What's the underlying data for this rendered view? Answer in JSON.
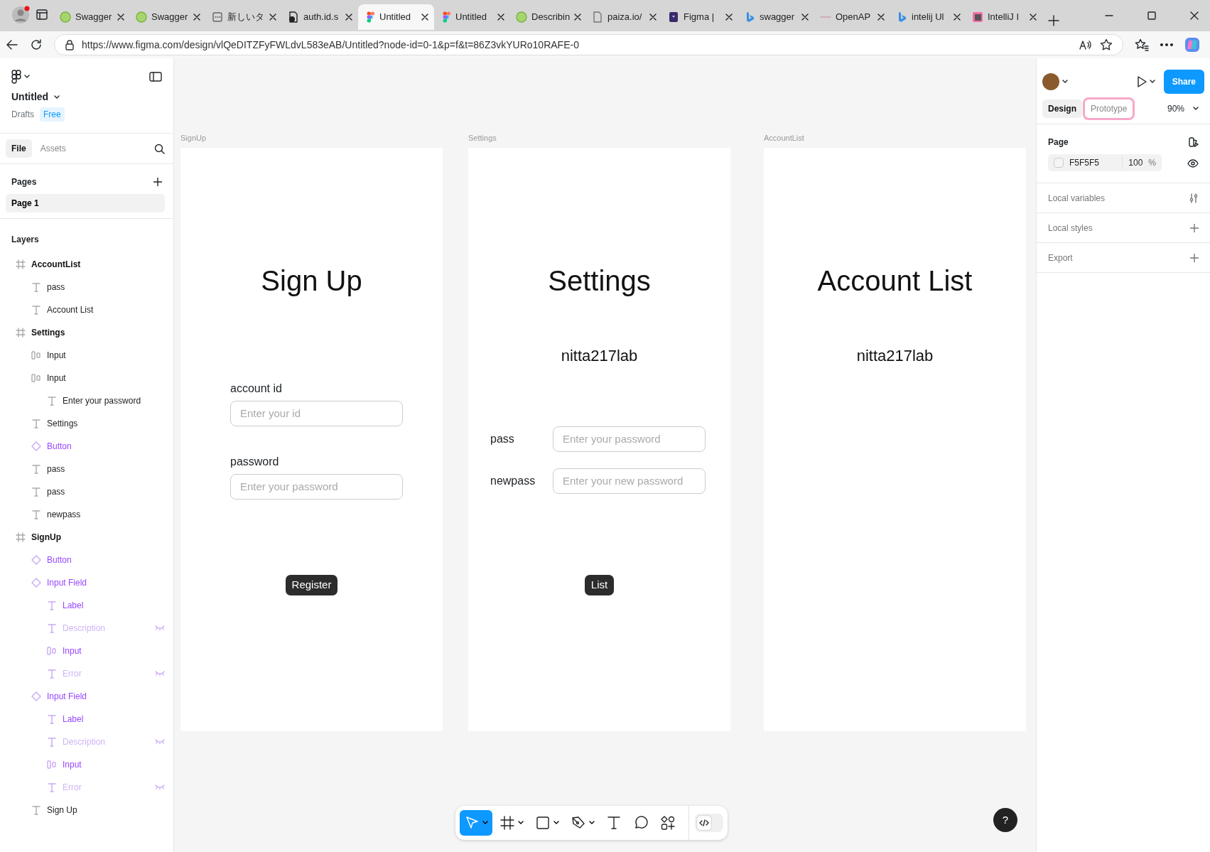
{
  "browser": {
    "tabs": [
      {
        "title": "Swagger",
        "kind": "swagger",
        "selected": false
      },
      {
        "title": "Swagger",
        "kind": "swagger",
        "selected": false
      },
      {
        "title": "新しいタ",
        "kind": "newtab",
        "selected": false
      },
      {
        "title": "auth.id.s",
        "kind": "doc",
        "selected": false
      },
      {
        "title": "Untitled",
        "kind": "figma",
        "selected": true
      },
      {
        "title": "Untitled",
        "kind": "figma",
        "selected": false
      },
      {
        "title": "Describin",
        "kind": "swagger",
        "selected": false
      },
      {
        "title": "paiza.io/",
        "kind": "page",
        "selected": false
      },
      {
        "title": "Figma |",
        "kind": "purple",
        "selected": false
      },
      {
        "title": "swagger",
        "kind": "bing",
        "selected": false
      },
      {
        "title": "OpenAP",
        "kind": "line",
        "selected": false
      },
      {
        "title": "intelij Ul",
        "kind": "bing",
        "selected": false
      },
      {
        "title": "IntelliJ I",
        "kind": "intellij",
        "selected": false
      }
    ],
    "url": "https://www.figma.com/design/vlQeDITZFyFWLdvL583eAB/Untitled?node-id=0-1&p=f&t=86Z3vkYURo10RAFE-0"
  },
  "left_panel": {
    "file_name": "Untitled",
    "location": "Drafts",
    "plan_badge": "Free",
    "tabs": [
      {
        "label": "File",
        "selected": true
      },
      {
        "label": "Assets",
        "selected": false
      }
    ],
    "pages_title": "Pages",
    "pages": [
      {
        "label": "Page 1",
        "selected": true
      }
    ],
    "layers_title": "Layers",
    "layers": [
      {
        "name": "AccountList",
        "kind": "frame",
        "children": [
          {
            "name": "pass",
            "kind": "text"
          },
          {
            "name": "Account List",
            "kind": "text"
          }
        ]
      },
      {
        "name": "Settings",
        "kind": "frame",
        "children": [
          {
            "name": "Input",
            "kind": "autolayout"
          },
          {
            "name": "Input",
            "kind": "autolayout",
            "children": [
              {
                "name": "Enter your password",
                "kind": "text"
              }
            ]
          },
          {
            "name": "Settings",
            "kind": "text"
          },
          {
            "name": "Button",
            "kind": "component"
          },
          {
            "name": "pass",
            "kind": "text"
          },
          {
            "name": "pass",
            "kind": "text"
          },
          {
            "name": "newpass",
            "kind": "text"
          }
        ]
      },
      {
        "name": "SignUp",
        "kind": "frame",
        "children": [
          {
            "name": "Button",
            "kind": "component"
          },
          {
            "name": "Input Field",
            "kind": "component",
            "children": [
              {
                "name": "Label",
                "kind": "text",
                "hidden": false
              },
              {
                "name": "Description",
                "kind": "text",
                "hidden": true
              },
              {
                "name": "Input",
                "kind": "autolayout",
                "hidden": false
              },
              {
                "name": "Error",
                "kind": "text",
                "hidden": true
              }
            ]
          },
          {
            "name": "Input Field",
            "kind": "component",
            "children": [
              {
                "name": "Label",
                "kind": "text",
                "hidden": false
              },
              {
                "name": "Description",
                "kind": "text",
                "hidden": true
              },
              {
                "name": "Input",
                "kind": "autolayout",
                "hidden": false
              },
              {
                "name": "Error",
                "kind": "text",
                "hidden": true
              }
            ]
          },
          {
            "name": "Sign Up",
            "kind": "text"
          }
        ]
      }
    ]
  },
  "canvas": {
    "frames": [
      {
        "label": "SignUp",
        "heading": "Sign Up",
        "kind": "stacked",
        "fields": [
          {
            "label": "account id",
            "placeholder": "Enter your id"
          },
          {
            "label": "password",
            "placeholder": "Enter your password"
          }
        ],
        "button": "Register"
      },
      {
        "label": "Settings",
        "heading": "Settings",
        "username": "nitta217lab",
        "kind": "inline",
        "fields": [
          {
            "label": "pass",
            "placeholder": "Enter your password"
          },
          {
            "label": "newpass",
            "placeholder": "Enter your new password"
          }
        ],
        "button": "List"
      },
      {
        "label": "AccountList",
        "heading": "Account List",
        "username": "nitta217lab"
      }
    ],
    "dev_mode_on": false,
    "toolbar": [
      {
        "kind": "move",
        "selected": true
      },
      {
        "kind": "frame",
        "selected": false
      },
      {
        "kind": "rect",
        "selected": false
      },
      {
        "kind": "pen",
        "selected": false
      },
      {
        "kind": "text",
        "selected": false
      },
      {
        "kind": "comment",
        "selected": false
      },
      {
        "kind": "actions",
        "selected": false
      }
    ],
    "help": "?"
  },
  "right_panel": {
    "share": "Share",
    "tabs": [
      {
        "label": "Design",
        "selected": true,
        "highlighted": false
      },
      {
        "label": "Prototype",
        "selected": false,
        "highlighted": true
      }
    ],
    "zoom": "90%",
    "page_title": "Page",
    "background": {
      "hex": "F5F5F5",
      "opacity": "100",
      "unit": "%"
    },
    "sections": [
      "Local variables",
      "Local styles",
      "Export"
    ]
  }
}
